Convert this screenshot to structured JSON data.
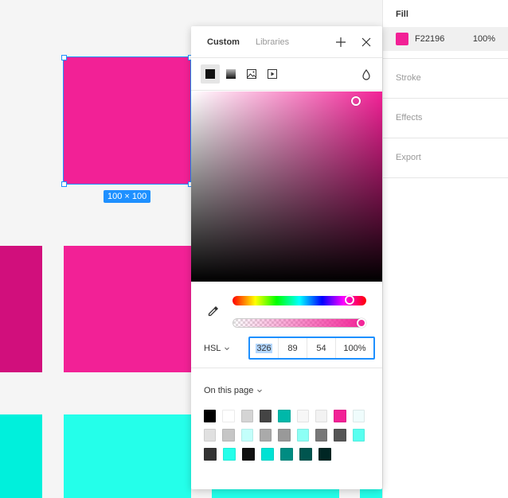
{
  "canvas": {
    "selection_label": "100 × 100"
  },
  "picker": {
    "tabs": [
      "Custom",
      "Libraries"
    ],
    "fill_types": [
      "solid",
      "gradient",
      "image",
      "video"
    ],
    "mode_label": "HSL",
    "values": [
      "326",
      "89",
      "54",
      "100%"
    ],
    "page_colors_label": "On this page",
    "hue": 0.9056,
    "saturation": 0.89,
    "lightness": 0.54,
    "alpha": 1.0,
    "swatches": [
      [
        "#000000",
        "#ffffff",
        "#d4d4d4",
        "#444444",
        "#00b8a9",
        "#f7f7f7",
        "#f2f2f2",
        "#f22196",
        "#effcfc"
      ],
      [
        "#e0e0e0",
        "#c6c6c6",
        "#c3fffb",
        "#aaaaaa",
        "#999999",
        "#8cfff5",
        "#777777",
        "#555555",
        "#58fff0"
      ],
      [
        "#333333",
        "#24ffea",
        "#111111",
        "#00e2d4",
        "#008c82",
        "#00554f",
        "#002624"
      ]
    ]
  },
  "props": {
    "fill_title": "Fill",
    "fill_hex": "F22196",
    "fill_opacity": "100%",
    "fill_color": "#f22196",
    "sections": [
      "Stroke",
      "Effects",
      "Export"
    ]
  },
  "colors": {
    "accent": "#1e90ff",
    "pink": "#f22196",
    "dark_pink": "#d10f7c",
    "cyan": "#24ffea",
    "cyan_alt": "#00f0dc"
  }
}
